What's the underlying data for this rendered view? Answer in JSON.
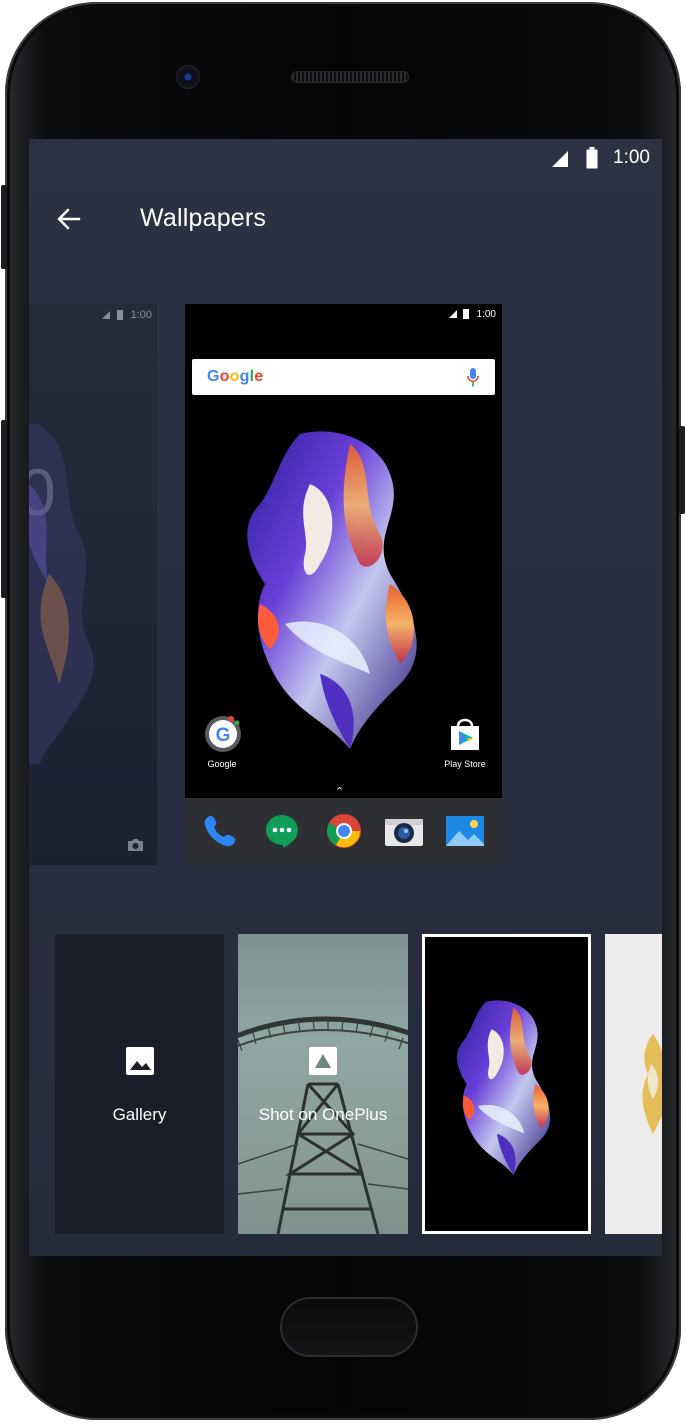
{
  "status_bar": {
    "time": "1:00"
  },
  "app_bar": {
    "title": "Wallpapers",
    "back_icon": "arrow-left-icon"
  },
  "lock_preview": {
    "status_time": "1:00",
    "clock_fragment": "0",
    "camera_icon": "camera-icon"
  },
  "home_preview": {
    "status_time": "1:00",
    "search": {
      "logo": "Google",
      "mic_icon": "mic-icon"
    },
    "apps": [
      {
        "label": "Google",
        "icon": "google-app-icon"
      },
      {
        "label": "Play Store",
        "icon": "play-store-icon"
      }
    ],
    "dock": [
      {
        "icon": "phone-icon"
      },
      {
        "icon": "hangouts-icon"
      },
      {
        "icon": "chrome-icon"
      },
      {
        "icon": "camera-icon"
      },
      {
        "icon": "gallery-icon"
      }
    ]
  },
  "wallpapers": [
    {
      "label": "Gallery",
      "icon": "image-icon"
    },
    {
      "label": "Shot on OnePlus",
      "icon": "oneplus-shot-icon"
    },
    {
      "label": "",
      "selected": true
    },
    {
      "label": ""
    }
  ],
  "colors": {
    "screen_bg": "#2a2f42",
    "selected_border": "#ffffff",
    "dock_bg": "#2d2f33"
  }
}
